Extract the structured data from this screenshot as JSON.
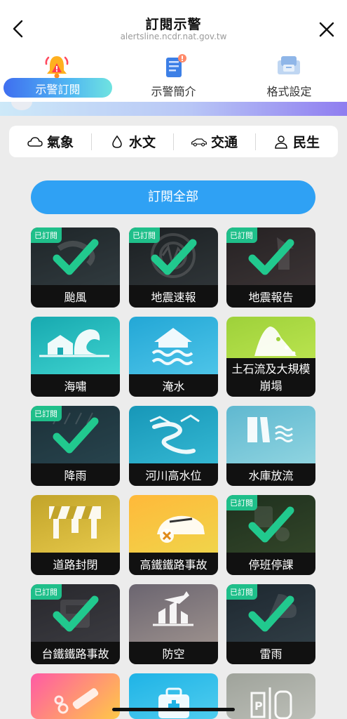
{
  "header": {
    "title": "訂閱示警",
    "subtitle": "alertsline.ncdr.nat.gov.tw",
    "back_icon": "chevron-left-icon",
    "close_icon": "close-icon"
  },
  "tabs": [
    {
      "label": "示警訂閱",
      "icon": "bell-alert-icon",
      "active": true
    },
    {
      "label": "示警簡介",
      "icon": "document-info-icon",
      "active": false
    },
    {
      "label": "格式設定",
      "icon": "settings-format-icon",
      "active": false
    }
  ],
  "categories": [
    {
      "label": "氣象",
      "icon": "cloud-icon"
    },
    {
      "label": "水文",
      "icon": "water-drop-icon"
    },
    {
      "label": "交通",
      "icon": "car-icon"
    },
    {
      "label": "民生",
      "icon": "person-icon"
    }
  ],
  "subscribe_all_label": "訂閱全部",
  "subscribed_badge": "已訂閱",
  "colors": {
    "accent": "#2fa1f4",
    "badge": "#1fbf8a",
    "check": "#21c98e"
  },
  "cards": [
    {
      "label": "颱風",
      "subscribed": true,
      "icon": "typhoon-icon"
    },
    {
      "label": "地震速報",
      "subscribed": true,
      "icon": "earthquake-wave-icon"
    },
    {
      "label": "地震報告",
      "subscribed": true,
      "icon": "earthquake-house-icon"
    },
    {
      "label": "海嘯",
      "subscribed": false,
      "icon": "tsunami-icon"
    },
    {
      "label": "淹水",
      "subscribed": false,
      "icon": "flood-icon"
    },
    {
      "label": "土石流及大規模崩塌",
      "subscribed": false,
      "icon": "landslide-icon"
    },
    {
      "label": "降雨",
      "subscribed": true,
      "icon": "rain-icon"
    },
    {
      "label": "河川高水位",
      "subscribed": false,
      "icon": "river-icon"
    },
    {
      "label": "水庫放流",
      "subscribed": false,
      "icon": "reservoir-icon"
    },
    {
      "label": "道路封閉",
      "subscribed": false,
      "icon": "road-barrier-icon"
    },
    {
      "label": "高鐵鐵路事故",
      "subscribed": false,
      "icon": "high-speed-rail-icon"
    },
    {
      "label": "停班停課",
      "subscribed": true,
      "icon": "school-closed-icon"
    },
    {
      "label": "台鐵鐵路事故",
      "subscribed": true,
      "icon": "train-icon"
    },
    {
      "label": "防空",
      "subscribed": false,
      "icon": "air-raid-icon"
    },
    {
      "label": "雷雨",
      "subscribed": true,
      "icon": "thunderstorm-icon"
    },
    {
      "label": "",
      "subscribed": false,
      "icon": "medical-syringe-icon"
    },
    {
      "label": "",
      "subscribed": false,
      "icon": "first-aid-kit-icon"
    },
    {
      "label": "",
      "subscribed": false,
      "icon": "parking-icon"
    }
  ]
}
